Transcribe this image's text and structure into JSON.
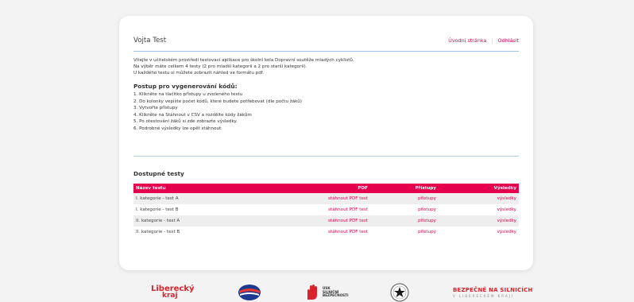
{
  "header": {
    "user": "Vojta Test",
    "nav": [
      "Úvodní stránka",
      "Odhlásit"
    ]
  },
  "intro": [
    "Vítejte v učitelském prostředí testovací aplikace pro školní kola Dopravní soutěže mladých cyklistů.",
    "Na výběr máte celkem 4 testy (2 pro mladší kategorii a 2 pro starší kategorii).",
    "U každého testu si můžete zobrazit náhled ve formátu pdf."
  ],
  "steps": {
    "title": "Postup pro vygenerování kódů:",
    "items": [
      "1. Klikněte na tlačítko přístupy u zvoleného testu",
      "2. Do kolonky vepište počet kódů, které budete potřebovat (dle počtu žáků)",
      "3. Vytvořte přístupy",
      "4. Klikněte na Stáhnout v CSV a rozdělte kódy žákům",
      "5. Po otestování žáků si zde zobrazte výsledky.",
      "6. Podrobné výsledky lze opět stáhnout"
    ]
  },
  "tests": {
    "title": "Dostupné testy",
    "columns": [
      "Název testu",
      "PDF",
      "Přístupy",
      "Výsledky"
    ],
    "rows": [
      {
        "name": "I. kategorie - test A",
        "pdf": "stáhnout PDF test",
        "access": "přístupy",
        "results": "výsledky"
      },
      {
        "name": "I. kategorie - test B",
        "pdf": "stáhnout PDF test",
        "access": "přístupy",
        "results": "výsledky"
      },
      {
        "name": "II. kategorie - test A",
        "pdf": "stáhnout PDF test",
        "access": "přístupy",
        "results": "výsledky"
      },
      {
        "name": "II. kategorie - test B",
        "pdf": "stáhnout PDF test",
        "access": "přístupy",
        "results": "výsledky"
      }
    ]
  },
  "logos": {
    "liberecky": [
      "Liberecký",
      "kraj"
    ],
    "hand": [
      "ÚSK",
      "SILNIČNÍ",
      "BEZPEČNOSTI"
    ],
    "bezpecne": [
      "BEZPEČNĚ NA SILNICÍCH",
      "V LIBERECKÉM KRAJI"
    ]
  },
  "colors": {
    "accent": "#e5004d",
    "divider": "#9cc4ea",
    "background": "#f3f3f3"
  }
}
